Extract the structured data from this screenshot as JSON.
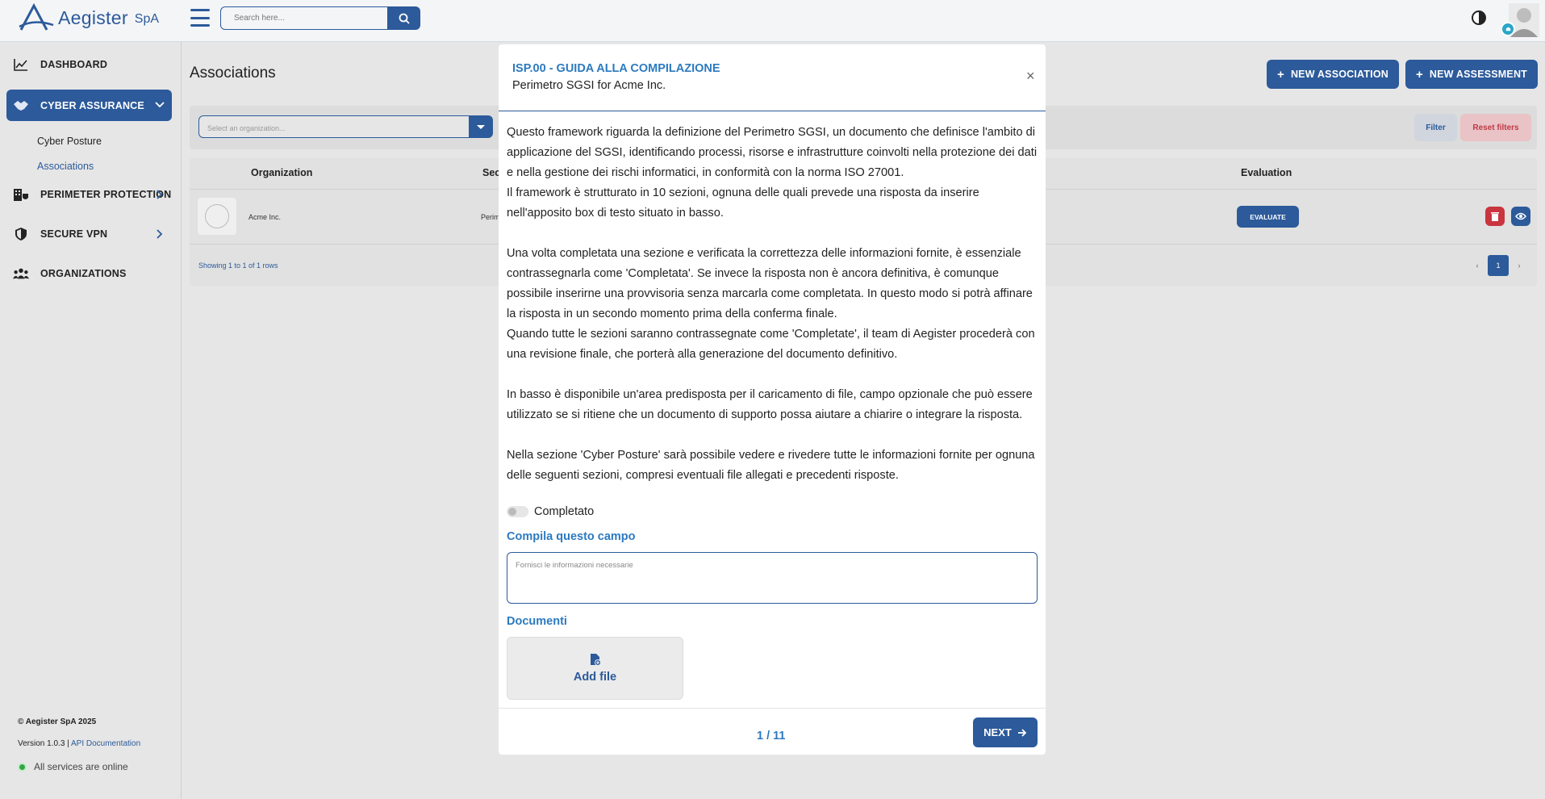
{
  "brand": {
    "name": "Aegister",
    "suffix": "SpA"
  },
  "header": {
    "search_placeholder": "Search here..."
  },
  "sidebar": {
    "items": [
      {
        "label": "DASHBOARD"
      },
      {
        "label": "CYBER ASSURANCE"
      },
      {
        "label": "PERIMETER PROTECTION"
      },
      {
        "label": "SECURE VPN"
      },
      {
        "label": "ORGANIZATIONS"
      }
    ],
    "subitems": [
      {
        "label": "Cyber Posture"
      },
      {
        "label": "Associations"
      }
    ],
    "footer": {
      "copyright": "© Aegister SpA 2025",
      "version": "Version 1.0.3 |",
      "api_link": "API Documentation",
      "status": "All services are online"
    }
  },
  "main": {
    "title": "Associations",
    "new_association": "NEW ASSOCIATION",
    "new_assessment": "NEW ASSESSMENT",
    "org_select_placeholder": "Select an organization...",
    "filter": "Filter",
    "reset_filters": "Reset filters",
    "table": {
      "columns": [
        "Organization",
        "Sec",
        "Evaluation"
      ],
      "rows": [
        {
          "organization": "Acme Inc.",
          "section": "Perim",
          "evaluate": "EVALUATE"
        }
      ]
    },
    "showing": "Showing 1 to 1 of 1 rows",
    "pager": {
      "prev": "‹",
      "current": "1",
      "next": "›"
    }
  },
  "modal": {
    "title": "ISP.00 - GUIDA ALLA COMPILAZIONE",
    "subtitle": "Perimetro SGSI for Acme Inc.",
    "close": "×",
    "paragraphs": [
      "Questo framework riguarda la definizione del Perimetro SGSI, un documento che definisce l'ambito di applicazione del SGSI, identificando processi, risorse e infrastrutture coinvolti nella protezione dei dati e nella gestione dei rischi informatici, in conformità con la norma ISO 27001.",
      "Il framework è strutturato in 10 sezioni, ognuna delle quali prevede una risposta da inserire nell'apposito box di testo situato in basso.",
      "Una volta completata una sezione e verificata la correttezza delle informazioni fornite, è essenziale contrassegnarla come 'Completata'. Se invece la risposta non è ancora definitiva, è comunque possibile inserirne una provvisoria senza marcarla come completata. In questo modo si potrà affinare la risposta in un secondo momento prima della conferma finale.",
      "Quando tutte le sezioni saranno contrassegnate come 'Completate', il team di Aegister procederà con una revisione finale, che porterà alla generazione del documento definitivo.",
      "In basso è disponibile un'area predisposta per il caricamento di file, campo opzionale che può essere utilizzato se si ritiene che un documento di supporto possa aiutare a chiarire o integrare la risposta.",
      "Nella sezione 'Cyber Posture' sarà possibile vedere e rivedere tutte le informazioni fornite per ognuna delle seguenti sezioni, compresi eventuali file allegati e precedenti risposte."
    ],
    "completed_label": "Completato",
    "field_label": "Compila questo campo",
    "textarea_placeholder": "Fornisci le informazioni necessarie",
    "documents_label": "Documenti",
    "add_file": "Add file",
    "page_count": "1 / 11",
    "next": "NEXT"
  },
  "colors": {
    "primary": "#2c5a9a",
    "accent": "#2c7ac0",
    "danger": "#c9343e",
    "online": "#2ea84a"
  }
}
